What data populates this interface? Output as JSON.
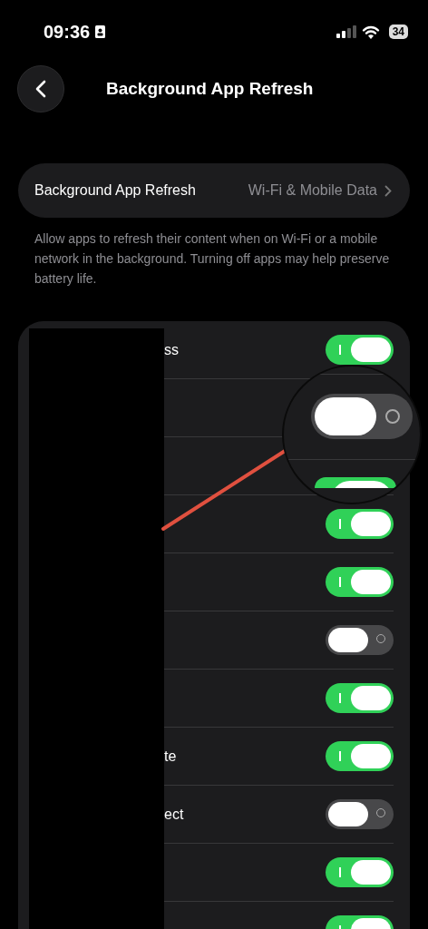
{
  "status_bar": {
    "time": "09:36",
    "battery": "34"
  },
  "nav": {
    "title": "Background App Refresh"
  },
  "setting": {
    "label": "Background App Refresh",
    "value": "Wi-Fi & Mobile Data"
  },
  "description": "Allow apps to refresh their content when on Wi-Fi or a mobile network in the background. Turning off apps may help preserve battery life.",
  "rows": [
    {
      "kind": "toggle",
      "label": "ss",
      "on": true
    },
    {
      "kind": "blank"
    },
    {
      "kind": "blank"
    },
    {
      "kind": "toggle",
      "on": true
    },
    {
      "kind": "toggle",
      "on": true
    },
    {
      "kind": "toggle",
      "on": false
    },
    {
      "kind": "toggle",
      "on": true
    },
    {
      "kind": "toggle",
      "label": "te",
      "on": true
    },
    {
      "kind": "toggle",
      "label": "ect",
      "on": false
    },
    {
      "kind": "toggle",
      "on": true
    },
    {
      "kind": "toggle",
      "on": true
    }
  ],
  "magnifier": {
    "toggles": [
      {
        "on": false
      },
      {
        "on": true
      }
    ]
  }
}
